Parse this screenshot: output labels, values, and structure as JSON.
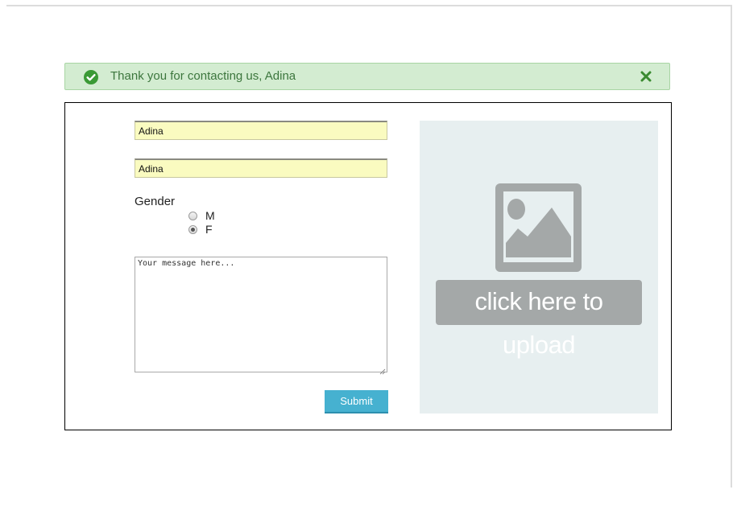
{
  "alert": {
    "message": "Thank you for contacting us, Adina",
    "icon": "check-circle-icon",
    "close_icon": "close-icon",
    "colors": {
      "background": "#d3ecd1",
      "text": "#3c763d",
      "icon": "#3a9a35"
    }
  },
  "form": {
    "first_name_value": "Adina",
    "last_name_value": "Adina",
    "gender_label": "Gender",
    "gender_options": [
      {
        "label": "M",
        "checked": false
      },
      {
        "label": "F",
        "checked": true
      }
    ],
    "message_placeholder": "Your message here...",
    "message_value": "",
    "submit_label": "Submit",
    "colors": {
      "input_background": "#fafbc0",
      "submit": "#46b1d0"
    }
  },
  "upload": {
    "text": "click here to upload",
    "icon": "image-placeholder-icon",
    "colors": {
      "background": "#e7eff0",
      "icon": "#a4a8a8"
    }
  }
}
